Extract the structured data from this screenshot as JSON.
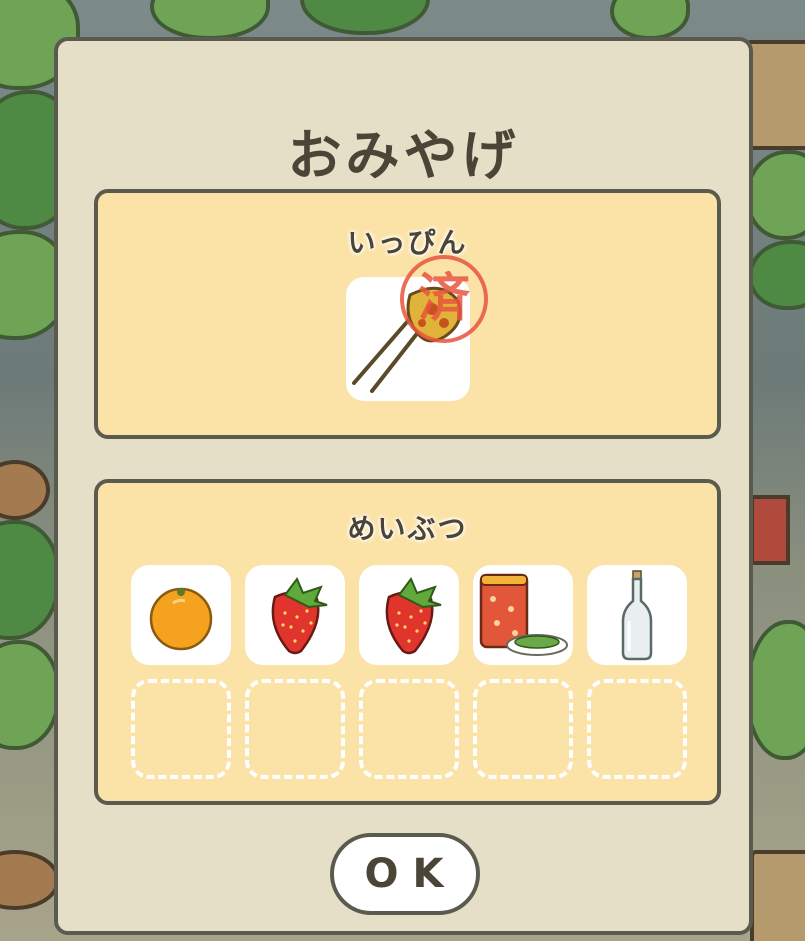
{
  "dialog": {
    "title": "おみやげ",
    "ok_label": "OK"
  },
  "special_item": {
    "heading": "いっぴん",
    "item_icon": "ornamental-hairpin-icon",
    "stamp_text": "済",
    "stamp_color": "#e8553f"
  },
  "souvenirs": {
    "heading": "めいぶつ",
    "items": [
      {
        "icon": "orange-icon"
      },
      {
        "icon": "strawberry-icon"
      },
      {
        "icon": "strawberry-icon"
      },
      {
        "icon": "tea-canister-icon"
      },
      {
        "icon": "glass-bottle-icon"
      }
    ],
    "empty_slots": 5
  },
  "colors": {
    "dialog_bg": "#e6dfc8",
    "panel_bg": "#fbe3a8",
    "border": "#5a5a4f",
    "text": "#4b4538"
  }
}
